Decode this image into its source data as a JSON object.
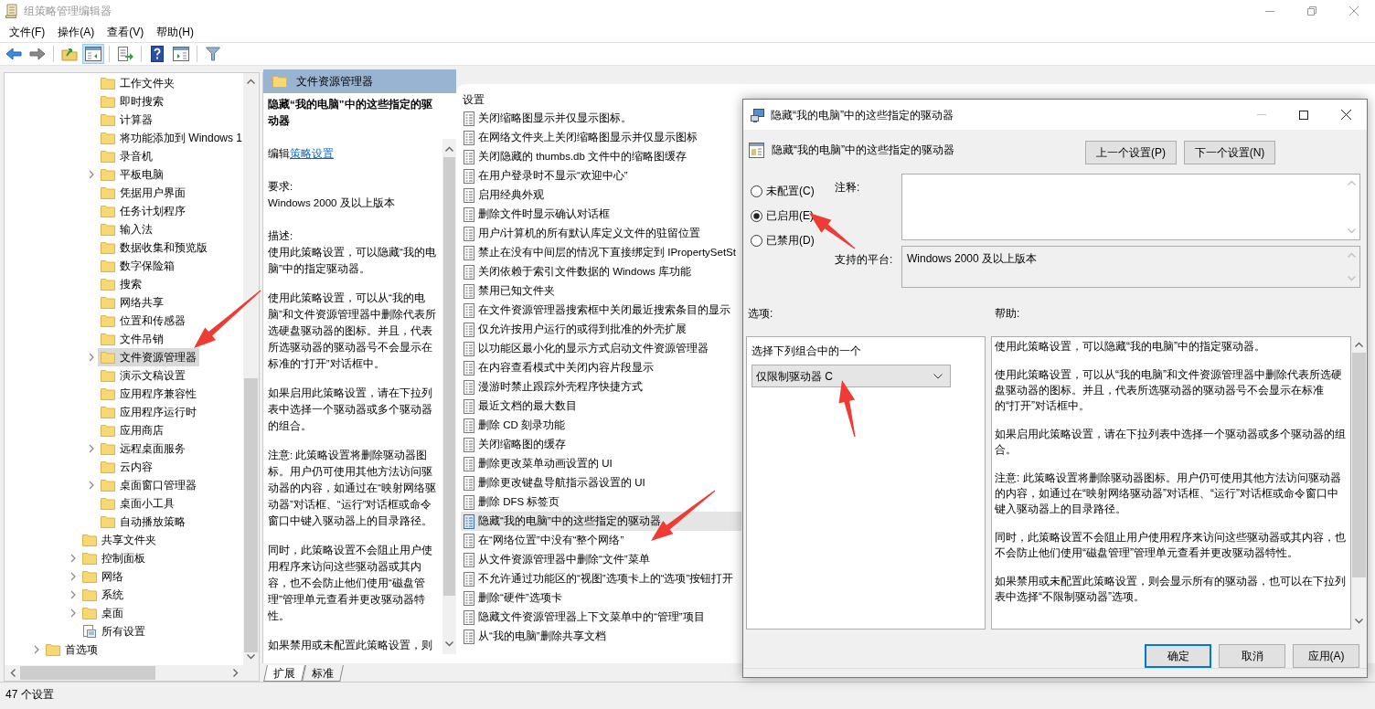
{
  "window": {
    "title": "组策略管理编辑器"
  },
  "menu": [
    "文件(F)",
    "操作(A)",
    "查看(V)",
    "帮助(H)"
  ],
  "toolbar": [
    {
      "kind": "back",
      "selected": false
    },
    {
      "kind": "forward",
      "selected": false
    },
    {
      "kind": "up",
      "selected": false
    },
    {
      "kind": "tree",
      "selected": true
    },
    {
      "kind": "export",
      "selected": false
    },
    {
      "kind": "help",
      "selected": false
    },
    {
      "kind": "pane",
      "selected": false
    },
    {
      "kind": "filter",
      "selected": false
    }
  ],
  "tree": [
    {
      "children": [
        {
          "children": [
            {
              "children": [
                {
                  "label": "工作文件夹",
                  "kind": "folder",
                  "expandable": false,
                  "selected": false
                },
                {
                  "label": "即时搜索",
                  "kind": "folder",
                  "expandable": false,
                  "selected": false
                },
                {
                  "label": "计算器",
                  "kind": "folder",
                  "expandable": false,
                  "selected": false
                },
                {
                  "label": "将功能添加到 Windows 1",
                  "kind": "folder",
                  "expandable": false,
                  "selected": false
                },
                {
                  "label": "录音机",
                  "kind": "folder",
                  "expandable": false,
                  "selected": false
                },
                {
                  "label": "平板电脑",
                  "kind": "folder",
                  "expandable": true,
                  "selected": false
                },
                {
                  "label": "凭据用户界面",
                  "kind": "folder",
                  "expandable": false,
                  "selected": false
                },
                {
                  "label": "任务计划程序",
                  "kind": "folder",
                  "expandable": false,
                  "selected": false
                },
                {
                  "label": "输入法",
                  "kind": "folder",
                  "expandable": false,
                  "selected": false
                },
                {
                  "label": "数据收集和预览版",
                  "kind": "folder",
                  "expandable": false,
                  "selected": false
                },
                {
                  "label": "数字保险箱",
                  "kind": "folder",
                  "expandable": false,
                  "selected": false
                },
                {
                  "label": "搜索",
                  "kind": "folder",
                  "expandable": false,
                  "selected": false
                },
                {
                  "label": "网络共享",
                  "kind": "folder",
                  "expandable": false,
                  "selected": false
                },
                {
                  "label": "位置和传感器",
                  "kind": "folder",
                  "expandable": false,
                  "selected": false
                },
                {
                  "label": "文件吊销",
                  "kind": "folder",
                  "expandable": false,
                  "selected": false
                },
                {
                  "label": "文件资源管理器",
                  "kind": "folder",
                  "expandable": true,
                  "selected": true
                },
                {
                  "label": "演示文稿设置",
                  "kind": "folder",
                  "expandable": false,
                  "selected": false
                },
                {
                  "label": "应用程序兼容性",
                  "kind": "folder",
                  "expandable": false,
                  "selected": false
                },
                {
                  "label": "应用程序运行时",
                  "kind": "folder",
                  "expandable": false,
                  "selected": false
                },
                {
                  "label": "应用商店",
                  "kind": "folder",
                  "expandable": false,
                  "selected": false
                },
                {
                  "label": "远程桌面服务",
                  "kind": "folder",
                  "expandable": true,
                  "selected": false
                },
                {
                  "label": "云内容",
                  "kind": "folder",
                  "expandable": false,
                  "selected": false
                },
                {
                  "label": "桌面窗口管理器",
                  "kind": "folder",
                  "expandable": true,
                  "selected": false
                },
                {
                  "label": "桌面小工具",
                  "kind": "folder",
                  "expandable": false,
                  "selected": false
                },
                {
                  "label": "自动播放策略",
                  "kind": "folder",
                  "expandable": false,
                  "selected": false
                }
              ]
            },
            {
              "label": "共享文件夹",
              "kind": "folder",
              "expandable": false,
              "selected": false
            },
            {
              "label": "控制面板",
              "kind": "folder",
              "expandable": true,
              "selected": false
            },
            {
              "label": "网络",
              "kind": "folder",
              "expandable": true,
              "selected": false
            },
            {
              "label": "系统",
              "kind": "folder",
              "expandable": true,
              "selected": false
            },
            {
              "label": "桌面",
              "kind": "folder",
              "expandable": true,
              "selected": false
            },
            {
              "label": "所有设置",
              "kind": "settings",
              "expandable": false,
              "selected": false
            }
          ]
        }
      ]
    },
    {
      "label": "首选项",
      "kind": "folder",
      "expandable": true,
      "selected": false
    }
  ],
  "description_pane": {
    "header": "文件资源管理器",
    "title": "隐藏“我的电脑”中的这些指定的驱动器",
    "edit_prefix": "编辑",
    "edit_link": "策略设置",
    "sections": [
      {
        "heading": "要求:",
        "paragraphs": [
          "Windows 2000 及以上版本"
        ]
      },
      {
        "heading": "描述:",
        "paragraphs": [
          "使用此策略设置，可以隐藏“我的电脑”中的指定驱动器。",
          "使用此策略设置，可以从“我的电脑”和文件资源管理器中删除代表所选硬盘驱动器的图标。并且，代表所选驱动器的驱动器号不会显示在标准的“打开”对话框中。",
          "如果启用此策略设置，请在下拉列表中选择一个驱动器或多个驱动器的组合。",
          "注意: 此策略设置将删除驱动器图标。用户仍可使用其他方法访问驱动器的内容，如通过在“映射网络驱动器”对话框、“运行”对话框或命令窗口中键入驱动器上的目录路径。",
          "同时，此策略设置不会阻止用户使用程序来访问这些驱动器或其内容，也不会防止他们使用“磁盘管理”管理单元查看并更改驱动器特性。",
          "如果禁用或未配置此策略设置，则"
        ]
      }
    ]
  },
  "settings_list": {
    "header": "设置",
    "items": [
      {
        "label": "关闭缩略图显示并仅显示图标。",
        "selected": false
      },
      {
        "label": "在网络文件夹上关闭缩略图显示并仅显示图标",
        "selected": false
      },
      {
        "label": "关闭隐藏的 thumbs.db 文件中的缩略图缓存",
        "selected": false
      },
      {
        "label": "在用户登录时不显示“欢迎中心”",
        "selected": false
      },
      {
        "label": "启用经典外观",
        "selected": false
      },
      {
        "label": "删除文件时显示确认对话框",
        "selected": false
      },
      {
        "label": "用户/计算机的所有默认库定义文件的驻留位置",
        "selected": false
      },
      {
        "label": "禁止在没有中间层的情况下直接绑定到 IPropertySetSt",
        "selected": false
      },
      {
        "label": "关闭依赖于索引文件数据的 Windows 库功能",
        "selected": false
      },
      {
        "label": "禁用已知文件夹",
        "selected": false
      },
      {
        "label": "在文件资源管理器搜索框中关闭最近搜索条目的显示",
        "selected": false
      },
      {
        "label": "仅允许按用户运行的或得到批准的外壳扩展",
        "selected": false
      },
      {
        "label": "以功能区最小化的显示方式启动文件资源管理器",
        "selected": false
      },
      {
        "label": "在内容查看模式中关闭内容片段显示",
        "selected": false
      },
      {
        "label": "漫游时禁止跟踪外壳程序快捷方式",
        "selected": false
      },
      {
        "label": "最近文档的最大数目",
        "selected": false
      },
      {
        "label": "删除 CD 刻录功能",
        "selected": false
      },
      {
        "label": "关闭缩略图的缓存",
        "selected": false
      },
      {
        "label": "删除更改菜单动画设置的 UI",
        "selected": false
      },
      {
        "label": "删除更改键盘导航指示器设置的 UI",
        "selected": false
      },
      {
        "label": "删除 DFS 标签页",
        "selected": false
      },
      {
        "label": "隐藏“我的电脑”中的这些指定的驱动器",
        "selected": true
      },
      {
        "label": "在“网络位置”中没有“整个网络”",
        "selected": false
      },
      {
        "label": "从文件资源管理器中删除“文件”菜单",
        "selected": false
      },
      {
        "label": "不允许通过功能区的“视图”选项卡上的“选项”按钮打开",
        "selected": false
      },
      {
        "label": "删除“硬件”选项卡",
        "selected": false
      },
      {
        "label": "隐藏文件资源管理器上下文菜单中的“管理”项目",
        "selected": false
      },
      {
        "label": "从“我的电脑”删除共享文档",
        "selected": false
      }
    ]
  },
  "view_tabs": [
    {
      "label": "扩展",
      "selected": true
    },
    {
      "label": "标准",
      "selected": false
    }
  ],
  "status_bar": "47 个设置",
  "dialog": {
    "title": "隐藏“我的电脑”中的这些指定的驱动器",
    "heading": "隐藏“我的电脑”中的这些指定的驱动器",
    "nav_buttons": [
      "上一个设置(P)",
      "下一个设置(N)"
    ],
    "states": [
      {
        "label": "未配置(C)",
        "selected": false
      },
      {
        "label": "已启用(E)",
        "selected": true
      },
      {
        "label": "已禁用(D)",
        "selected": false
      }
    ],
    "comment_label": "注释:",
    "platform_label": "支持的平台:",
    "platform_value": "Windows 2000 及以上版本",
    "options_label": "选项:",
    "help_label": "帮助:",
    "options_prompt": "选择下列组合中的一个",
    "drive_choice": "仅限制驱动器 C",
    "help_paragraphs": [
      "使用此策略设置，可以隐藏“我的电脑”中的指定驱动器。",
      "使用此策略设置，可以从“我的电脑”和文件资源管理器中删除代表所选硬盘驱动器的图标。并且，代表所选驱动器的驱动器号不会显示在标准的“打开”对话框中。",
      "如果启用此策略设置，请在下拉列表中选择一个驱动器或多个驱动器的组合。",
      "注意: 此策略设置将删除驱动器图标。用户仍可使用其他方法访问驱动器的内容，如通过在“映射网络驱动器”对话框、“运行”对话框或命令窗口中键入驱动器上的目录路径。",
      "同时，此策略设置不会阻止用户使用程序来访问这些驱动器或其内容，也不会防止他们使用“磁盘管理”管理单元查看并更改驱动器特性。",
      "如果禁用或未配置此策略设置，则会显示所有的驱动器，也可以在下拉列表中选择“不限制驱动器”选项。"
    ],
    "footer_buttons": [
      {
        "label": "确定",
        "focused": true
      },
      {
        "label": "取消",
        "focused": false
      },
      {
        "label": "应用(A)",
        "focused": false
      }
    ]
  }
}
